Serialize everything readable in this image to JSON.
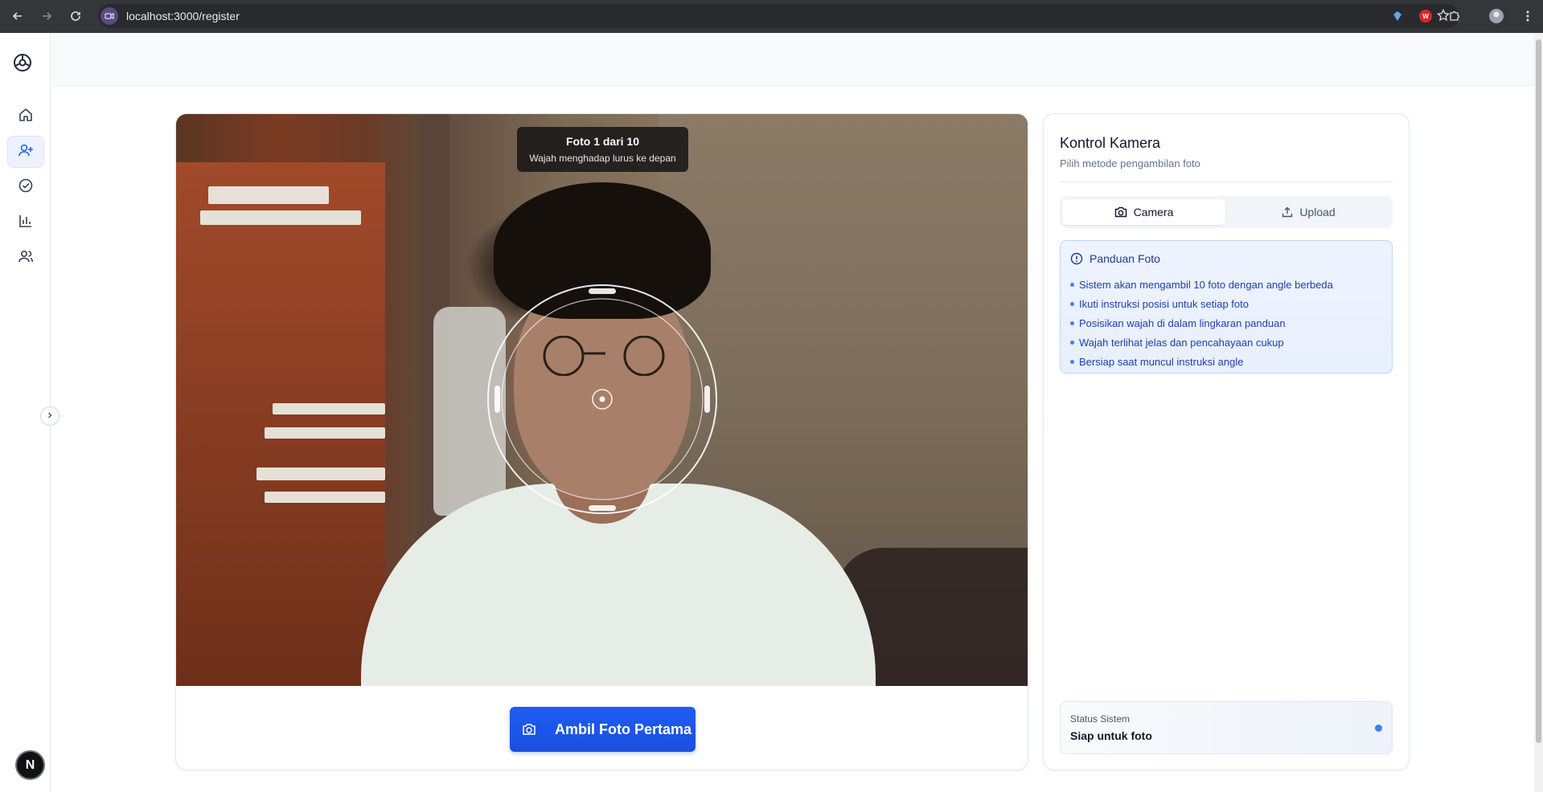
{
  "browser": {
    "url": "localhost:3000/register"
  },
  "sidebar": {
    "items": [
      {
        "name": "home",
        "icon": "home-icon"
      },
      {
        "name": "register",
        "icon": "user-plus-icon",
        "active": true
      },
      {
        "name": "attendance",
        "icon": "check-circle-icon"
      },
      {
        "name": "reports",
        "icon": "bar-chart-icon"
      },
      {
        "name": "users",
        "icon": "users-icon"
      }
    ],
    "avatar_letter": "N"
  },
  "camera": {
    "instruction_title": "Foto 1 dari 10",
    "instruction_subtitle": "Wajah menghadap lurus ke depan",
    "capture_button": "Ambil Foto Pertama"
  },
  "controls": {
    "title": "Kontrol Kamera",
    "subtitle": "Pilih metode pengambilan foto",
    "tabs": [
      {
        "label": "Camera",
        "icon": "camera-icon",
        "active": true
      },
      {
        "label": "Upload",
        "icon": "upload-icon",
        "active": false
      }
    ],
    "guide": {
      "title": "Panduan Foto",
      "items": [
        "Sistem akan mengambil 10 foto dengan angle berbeda",
        "Ikuti instruksi posisi untuk setiap foto",
        "Posisikan wajah di dalam lingkaran panduan",
        "Wajah terlihat jelas dan pencahayaan cukup",
        "Bersiap saat muncul instruksi angle"
      ]
    },
    "status": {
      "label": "Status Sistem",
      "value": "Siap untuk foto"
    }
  },
  "colors": {
    "accent": "#1d4ed8",
    "status_dot": "#3b82f6",
    "guide_bg": "#eef4ff"
  }
}
